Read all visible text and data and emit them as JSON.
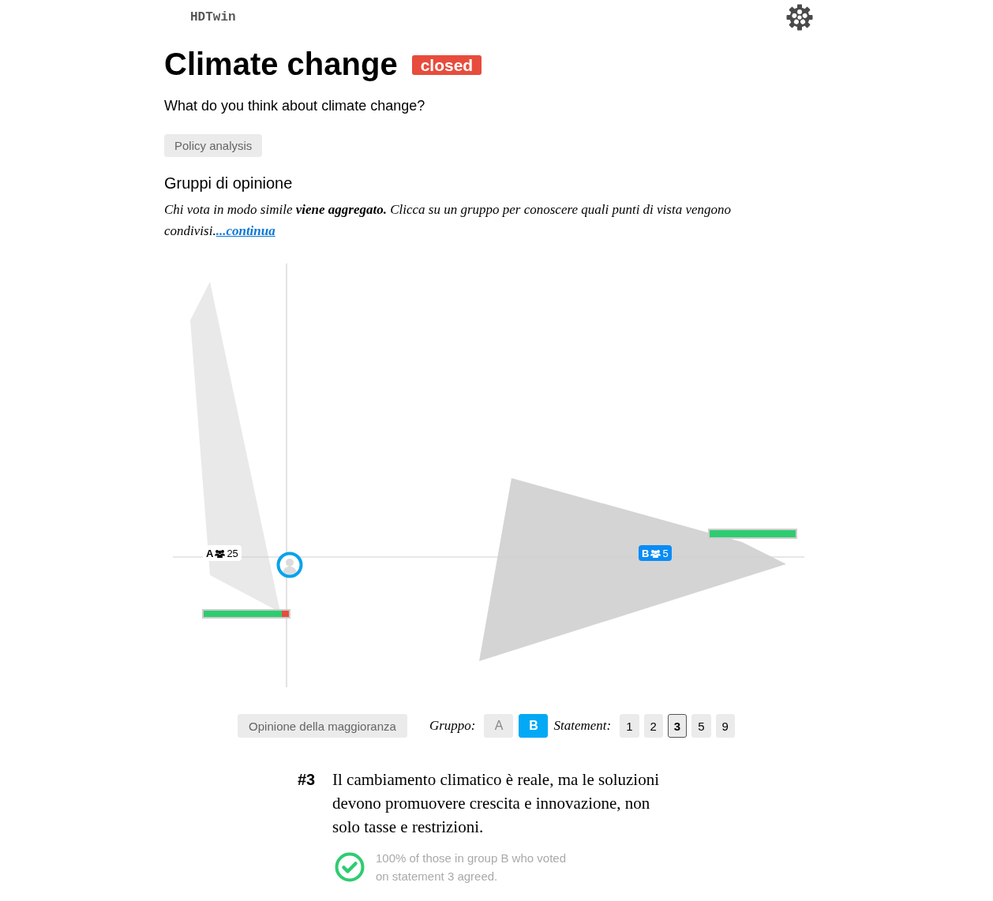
{
  "header": {
    "brand": "HDTwin"
  },
  "title": "Climate change",
  "status_badge": "closed",
  "question": "What do you think about climate change?",
  "topic_button": "Policy analysis",
  "section": {
    "heading": "Gruppi di opinione",
    "intro": "Chi vota in modo simile **viene aggregato.** Clicca su un gruppo per conoscere quali punti di vista vengono condivisi.",
    "more_link": "...continua"
  },
  "opinion_map": {
    "groups": [
      {
        "label": "A",
        "count": "25",
        "selected": false,
        "level": 0.92
      },
      {
        "label": "B",
        "count": "5",
        "selected": true,
        "level": 1
      }
    ]
  },
  "controls": {
    "majority_button": "Opinione della maggioranza",
    "group_label": "Gruppo:",
    "groups": [
      {
        "label": "A",
        "selected": false
      },
      {
        "label": "B",
        "selected": true
      }
    ],
    "statement_label": "Statement:",
    "statements": [
      {
        "label": "1",
        "selected": false
      },
      {
        "label": "2",
        "selected": false
      },
      {
        "label": "3",
        "selected": true
      },
      {
        "label": "5",
        "selected": false
      },
      {
        "label": "9",
        "selected": false
      }
    ]
  },
  "statement": {
    "number": "#3",
    "text": "Il cambiamento climatico è reale, ma le soluzioni devono promuovere crescita e innovazione, non solo tasse e restrizioni.",
    "result": "100% of those in group B who voted on statement 3 agreed."
  }
}
